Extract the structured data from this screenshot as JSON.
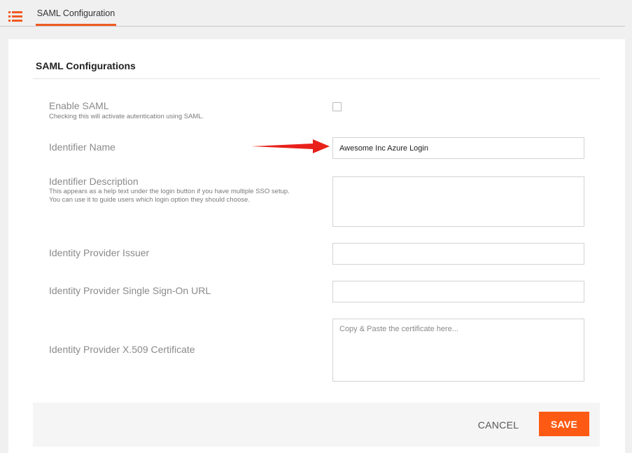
{
  "header": {
    "menu_icon": "list-icon",
    "tab_label": "SAML Configuration",
    "accent_color": "#f05a22"
  },
  "section": {
    "title": "SAML Configurations"
  },
  "form": {
    "enable_saml": {
      "label": "Enable SAML",
      "help": "Checking this will activate autentication using SAML.",
      "checked": false
    },
    "identifier_name": {
      "label": "Identifier Name",
      "value": "Awesome Inc Azure Login"
    },
    "identifier_description": {
      "label": "Identifier Description",
      "help": "This appears as a help text under the login button if you have multiple SSO setup. You can use it to guide users which login option they should choose.",
      "value": ""
    },
    "idp_issuer": {
      "label": "Identity Provider Issuer",
      "value": ""
    },
    "idp_sso_url": {
      "label": "Identity Provider Single Sign-On URL",
      "value": ""
    },
    "idp_certificate": {
      "label": "Identity Provider X.509 Certificate",
      "placeholder": "Copy & Paste the certificate here...",
      "value": ""
    }
  },
  "annotation": {
    "arrow_icon": "red-arrow-icon",
    "arrow_color": "#e8211a"
  },
  "footer": {
    "cancel_label": "CANCEL",
    "save_label": "SAVE",
    "save_color": "#ff5a14"
  }
}
